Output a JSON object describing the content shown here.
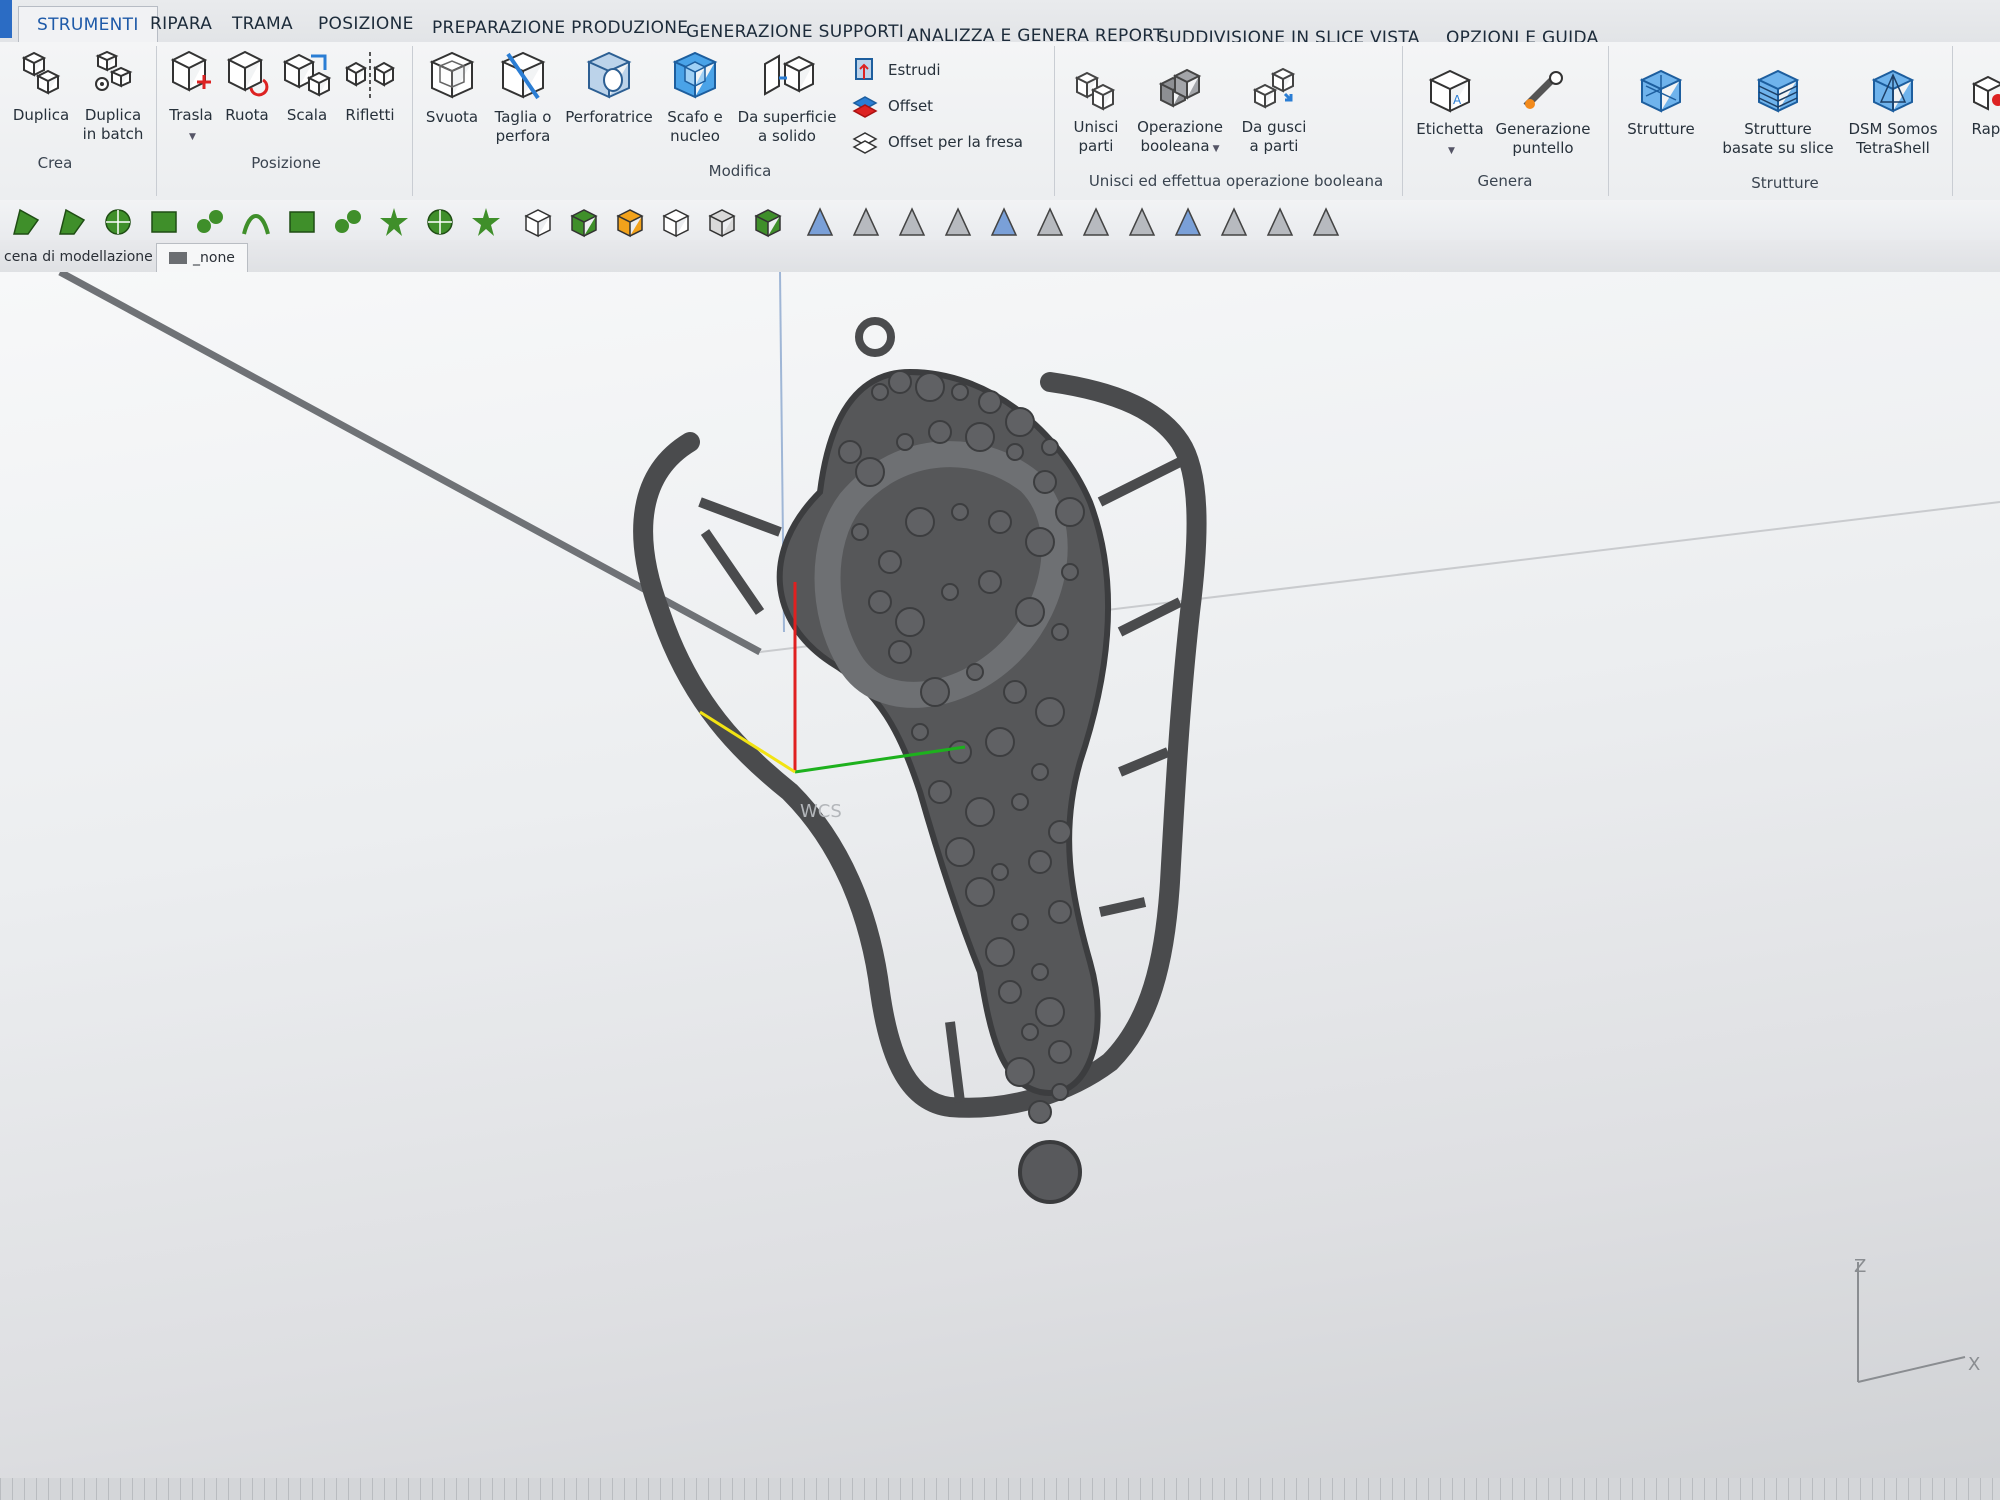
{
  "tabs": [
    "STRUMENTI",
    "RIPARA",
    "TRAMA",
    "POSIZIONE",
    "PREPARAZIONE PRODUZIONE",
    "GENERAZIONE SUPPORTI",
    "ANALIZZA E GENERA REPORT",
    "SUDDIVISIONE IN SLICE",
    "VISTA",
    "OPZIONI E GUIDA"
  ],
  "active_tab": "STRUMENTI",
  "ribbon": {
    "crea": {
      "group": "Crea",
      "duplica": "Duplica",
      "duplica_batch": "Duplica\nin batch"
    },
    "posizione": {
      "group": "Posizione",
      "trasla": "Trasla",
      "ruota": "Ruota",
      "scala": "Scala",
      "rifletti": "Rifletti"
    },
    "modifica": {
      "group": "Modifica",
      "svuota": "Svuota",
      "taglia": "Taglia o\nperfora",
      "perforatrice": "Perforatrice",
      "scafo": "Scafo e\nnucleo",
      "superficie": "Da superficie\na solido",
      "estrudi": "Estrudi",
      "offset": "Offset",
      "offset_fresa": "Offset per la fresa"
    },
    "unisci": {
      "group": "Unisci ed effettua operazione booleana",
      "unisci_parti": "Unisci\nparti",
      "booleana": "Operazione\nbooleana",
      "gusci": "Da gusci\na parti"
    },
    "genera": {
      "group": "Genera",
      "etichetta": "Etichetta",
      "puntello": "Generazione\npuntello"
    },
    "strutture": {
      "group": "Strutture",
      "strutture": "Strutture",
      "slice": "Strutture\nbasate su slice",
      "dsm": "DSM Somos\nTetraShell"
    },
    "rapid": "Rapi"
  },
  "scene_tabs": [
    "cena di modellazione",
    "_none"
  ],
  "viewport": {
    "wcs_label": "WCS",
    "axis_z": "Z",
    "axis_x": "X"
  },
  "colors": {
    "active_tab_text": "#1e5aa8",
    "toolbar_green": "#3f8f2a",
    "axis_red": "#e02020",
    "axis_green": "#1db11d",
    "axis_yellow": "#f2e313",
    "model_gray": "#4a4b4d"
  }
}
